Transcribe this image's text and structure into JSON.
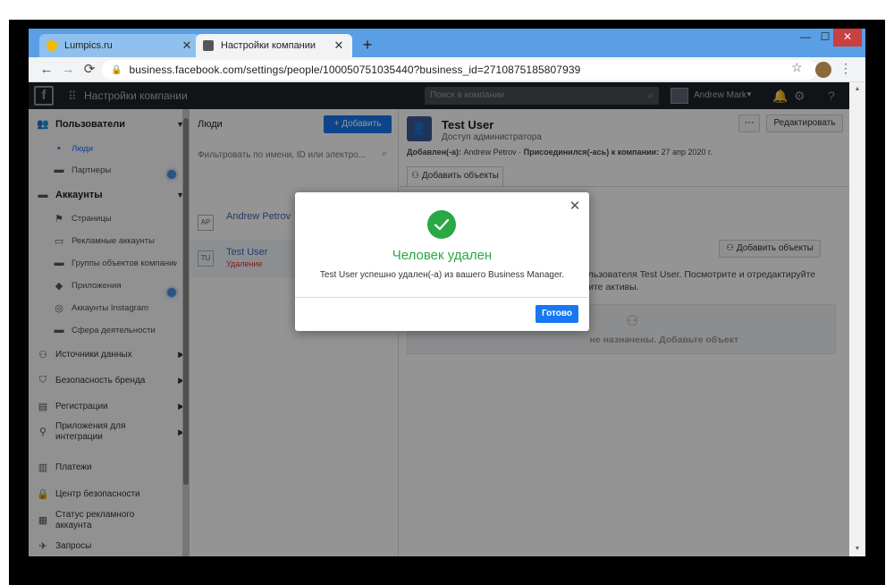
{
  "browser": {
    "tabs": [
      {
        "title": "Lumpics.ru",
        "icon": "lumpics-favicon",
        "active": false
      },
      {
        "title": "Настройки компании",
        "icon": "facebook-business-favicon",
        "active": true
      }
    ],
    "new_tab": "+",
    "url": "business.facebook.com/settings/people/100050751035440?business_id=2710875185807939",
    "window_controls": {
      "minimize": "—",
      "maximize": "☐",
      "close": "✕"
    }
  },
  "header": {
    "logo": "f",
    "title": "Настройки компании",
    "search_placeholder": "Поиск в компании",
    "user_name": "Andrew Mark"
  },
  "sidebar": {
    "items": [
      {
        "label": "Пользователи",
        "icon": "users-icon",
        "type": "section",
        "expanded": true
      },
      {
        "label": "Люди",
        "icon": "person-icon",
        "type": "sub",
        "active": true
      },
      {
        "label": "Партнеры",
        "icon": "briefcase-icon",
        "type": "sub"
      },
      {
        "label": "Аккаунты",
        "icon": "accounts-icon",
        "type": "section",
        "expanded": true
      },
      {
        "label": "Страницы",
        "icon": "flag-icon",
        "type": "sub"
      },
      {
        "label": "Рекламные аккаунты",
        "icon": "ad-account-icon",
        "type": "sub"
      },
      {
        "label": "Группы объектов компании",
        "icon": "folder-icon",
        "type": "sub"
      },
      {
        "label": "Приложения",
        "icon": "cube-icon",
        "type": "sub"
      },
      {
        "label": "Аккаунты Instagram",
        "icon": "instagram-icon",
        "type": "sub"
      },
      {
        "label": "Сфера деятельности",
        "icon": "briefcase-icon",
        "type": "sub"
      },
      {
        "label": "Источники данных",
        "icon": "data-sources-icon",
        "type": "section"
      },
      {
        "label": "Безопасность бренда",
        "icon": "shield-icon",
        "type": "section"
      },
      {
        "label": "Регистрации",
        "icon": "clipboard-icon",
        "type": "section"
      },
      {
        "label": "Приложения для интеграции",
        "icon": "integrations-icon",
        "type": "section"
      },
      {
        "label": "Платежи",
        "icon": "bank-icon",
        "type": "plain"
      },
      {
        "label": "Центр безопасности",
        "icon": "lock-icon",
        "type": "plain"
      },
      {
        "label": "Статус рекламного аккаунта",
        "icon": "status-icon",
        "type": "plain"
      },
      {
        "label": "Запросы",
        "icon": "requests-icon",
        "type": "plain"
      }
    ]
  },
  "people_column": {
    "title": "Люди",
    "add_button": "Добавить",
    "filter_placeholder": "Фильтровать по имени, ID или электро...",
    "people": [
      {
        "initials": "AP",
        "name": "Andrew Petrov",
        "status": ""
      },
      {
        "initials": "TU",
        "name": "Test User",
        "status": "Удаление"
      }
    ]
  },
  "detail": {
    "name": "Test User",
    "role": "Доступ администратора",
    "added_label": "Добавлен(-а):",
    "added_by": "Andrew Petrov",
    "separator": "·",
    "joined_label": "Присоединился(-ась) к компании:",
    "joined_date": "27 апр 2020 г.",
    "more_button": "···",
    "edit_button": "Редактировать",
    "tab_assets": "Добавить объекты",
    "add_assets_button": "Добавить объекты",
    "description": "ользователя Test User. Посмотрите и отредактируйте\nлите активы.",
    "empty_text": "не назначены. Добавьте объект"
  },
  "modal": {
    "title": "Человек удален",
    "message": "Test User успешно удален(-а) из вашего Business Manager.",
    "done_button": "Готово",
    "colors": {
      "success": "#2aa845",
      "primary": "#1877f2"
    }
  }
}
